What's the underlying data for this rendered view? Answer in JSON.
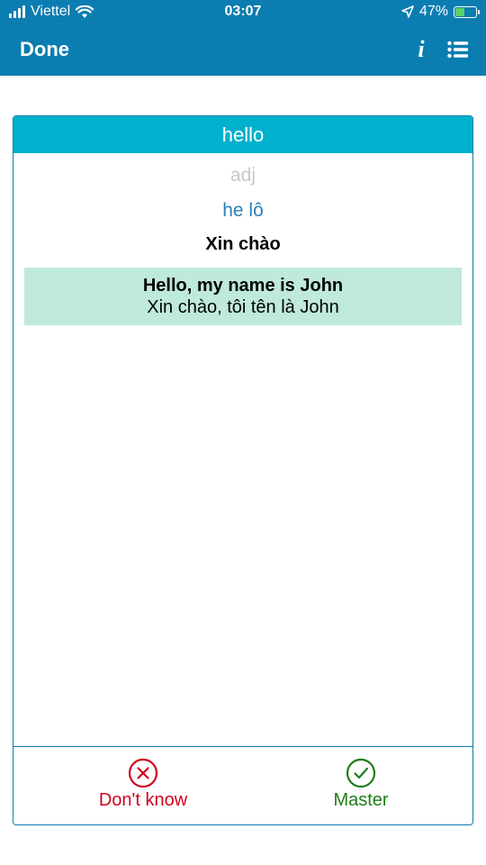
{
  "status_bar": {
    "carrier": "Viettel",
    "time": "03:07",
    "battery_percent": "47%",
    "battery_level": 0.47
  },
  "nav": {
    "done_label": "Done",
    "info_icon": "info-icon",
    "list_icon": "list-icon"
  },
  "card": {
    "word": "hello",
    "part_of_speech": "adj",
    "pronunciation": "he lô",
    "meaning": "Xin chào",
    "example_en": "Hello, my name is John",
    "example_vi": "Xin chào, tôi tên là John"
  },
  "actions": {
    "dont_know_label": "Don't know",
    "master_label": "Master"
  },
  "colors": {
    "nav_bg": "#0b7db0",
    "card_header_bg": "#00b1cd",
    "example_bg": "#bfe9dc",
    "dont_know": "#d0021b",
    "master": "#1e7c17",
    "pronunciation": "#2a82b7"
  }
}
